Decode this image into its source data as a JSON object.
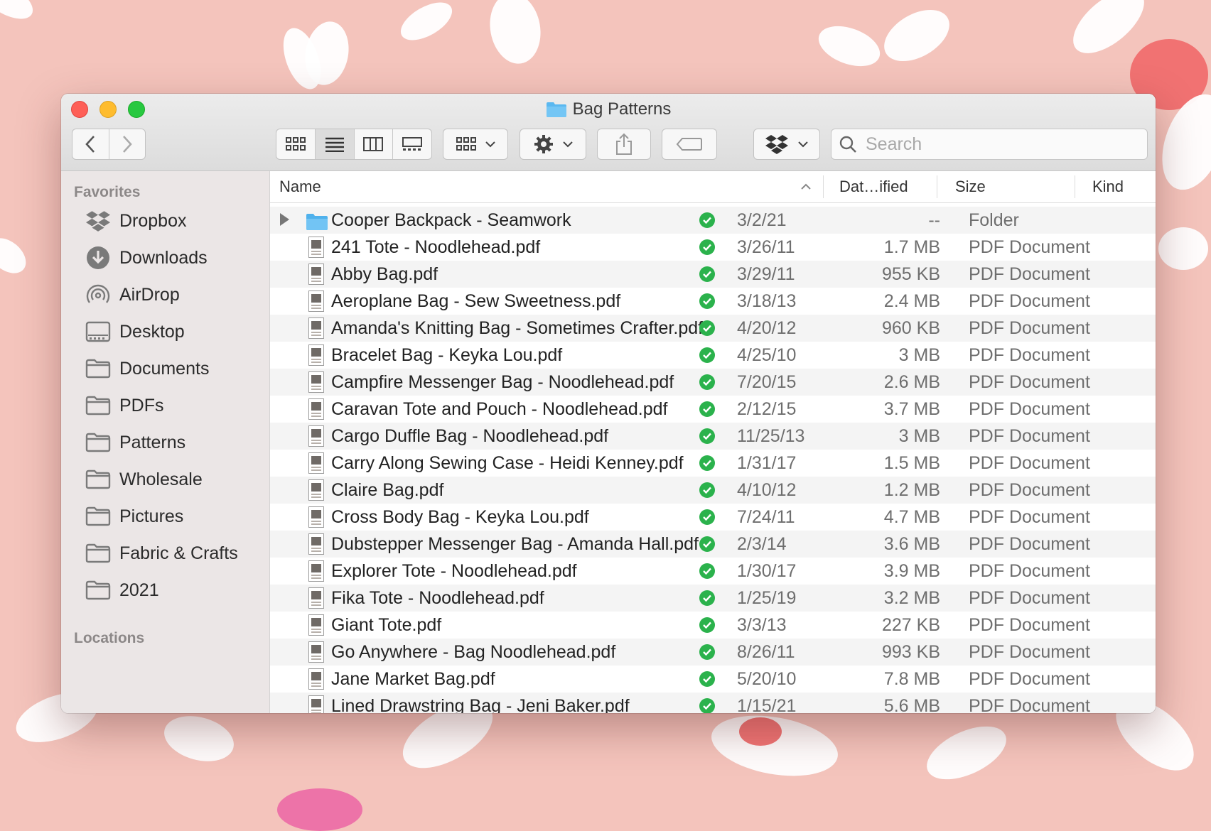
{
  "window": {
    "title": "Bag Patterns"
  },
  "toolbar": {
    "back_icon": "chevron-left-icon",
    "forward_icon": "chevron-right-icon",
    "view_icons": [
      "icon-view-icon",
      "list-view-icon",
      "column-view-icon",
      "gallery-view-icon"
    ],
    "active_view": "list",
    "group_icon": "group-by-icon",
    "action_icon": "gear-icon",
    "share_icon": "share-icon",
    "tag_icon": "tag-icon",
    "dropbox_icon": "dropbox-icon",
    "search_placeholder": "Search"
  },
  "sidebar": {
    "favorites_label": "Favorites",
    "locations_label": "Locations",
    "items": [
      {
        "label": "Dropbox",
        "icon": "dropbox-icon"
      },
      {
        "label": "Downloads",
        "icon": "download-icon"
      },
      {
        "label": "AirDrop",
        "icon": "airdrop-icon"
      },
      {
        "label": "Desktop",
        "icon": "desktop-icon"
      },
      {
        "label": "Documents",
        "icon": "folder-icon"
      },
      {
        "label": "PDFs",
        "icon": "folder-icon"
      },
      {
        "label": "Patterns",
        "icon": "folder-icon"
      },
      {
        "label": "Wholesale",
        "icon": "folder-icon"
      },
      {
        "label": "Pictures",
        "icon": "folder-icon"
      },
      {
        "label": "Fabric & Crafts",
        "icon": "folder-icon"
      },
      {
        "label": "2021",
        "icon": "folder-icon"
      }
    ]
  },
  "columns": {
    "name": "Name",
    "date": "Dat…ified",
    "size": "Size",
    "kind": "Kind"
  },
  "files": [
    {
      "name": "Cooper Backpack - Seamwork",
      "date": "3/2/21",
      "size": "--",
      "kind": "Folder",
      "is_folder": true
    },
    {
      "name": "241 Tote - Noodlehead.pdf",
      "date": "3/26/11",
      "size": "1.7 MB",
      "kind": "PDF Document"
    },
    {
      "name": "Abby Bag.pdf",
      "date": "3/29/11",
      "size": "955 KB",
      "kind": "PDF Document"
    },
    {
      "name": "Aeroplane Bag - Sew Sweetness.pdf",
      "date": "3/18/13",
      "size": "2.4 MB",
      "kind": "PDF Document"
    },
    {
      "name": "Amanda's Knitting Bag - Sometimes Crafter.pdf",
      "date": "4/20/12",
      "size": "960 KB",
      "kind": "PDF Document"
    },
    {
      "name": "Bracelet Bag - Keyka Lou.pdf",
      "date": "4/25/10",
      "size": "3 MB",
      "kind": "PDF Document"
    },
    {
      "name": "Campfire Messenger Bag - Noodlehead.pdf",
      "date": "7/20/15",
      "size": "2.6 MB",
      "kind": "PDF Document"
    },
    {
      "name": "Caravan Tote and Pouch - Noodlehead.pdf",
      "date": "2/12/15",
      "size": "3.7 MB",
      "kind": "PDF Document"
    },
    {
      "name": "Cargo Duffle Bag - Noodlehead.pdf",
      "date": "11/25/13",
      "size": "3 MB",
      "kind": "PDF Document"
    },
    {
      "name": "Carry Along Sewing Case - Heidi Kenney.pdf",
      "date": "1/31/17",
      "size": "1.5 MB",
      "kind": "PDF Document"
    },
    {
      "name": "Claire Bag.pdf",
      "date": "4/10/12",
      "size": "1.2 MB",
      "kind": "PDF Document"
    },
    {
      "name": "Cross Body Bag - Keyka Lou.pdf",
      "date": "7/24/11",
      "size": "4.7 MB",
      "kind": "PDF Document"
    },
    {
      "name": "Dubstepper Messenger Bag - Amanda Hall.pdf",
      "date": "2/3/14",
      "size": "3.6 MB",
      "kind": "PDF Document"
    },
    {
      "name": "Explorer Tote - Noodlehead.pdf",
      "date": "1/30/17",
      "size": "3.9 MB",
      "kind": "PDF Document"
    },
    {
      "name": "Fika Tote - Noodlehead.pdf",
      "date": "1/25/19",
      "size": "3.2 MB",
      "kind": "PDF Document"
    },
    {
      "name": "Giant Tote.pdf",
      "date": "3/3/13",
      "size": "227 KB",
      "kind": "PDF Document"
    },
    {
      "name": "Go Anywhere - Bag Noodlehead.pdf",
      "date": "8/26/11",
      "size": "993 KB",
      "kind": "PDF Document"
    },
    {
      "name": "Jane Market Bag.pdf",
      "date": "5/20/10",
      "size": "7.8 MB",
      "kind": "PDF Document"
    },
    {
      "name": "Lined Drawstring Bag - Jeni Baker.pdf",
      "date": "1/15/21",
      "size": "5.6 MB",
      "kind": "PDF Document"
    }
  ],
  "colors": {
    "sync_green": "#2bb24c",
    "folder_blue": "#5ab8f0",
    "accent_wallpaper": "#f4c4bc"
  }
}
